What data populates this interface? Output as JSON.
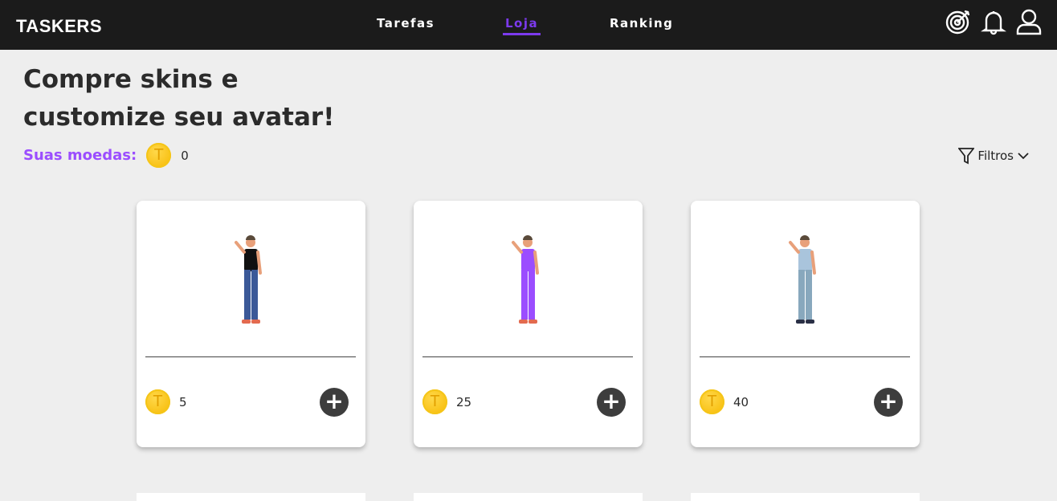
{
  "nav": {
    "logo": "TASKERS",
    "links": [
      {
        "label": "Tarefas",
        "active": false
      },
      {
        "label": "Loja",
        "active": true
      },
      {
        "label": "Ranking",
        "active": false
      }
    ],
    "icons": [
      "target-icon",
      "bell-icon",
      "user-icon"
    ],
    "accent": "#7c3aed"
  },
  "page": {
    "title_line1": "Compre skins e",
    "title_line2": "customize seu avatar!",
    "coins_label": "Suas moedas:",
    "coins_value": "0",
    "coin_symbol": "T",
    "filter_label": "Filtros"
  },
  "cards": [
    {
      "price": "5",
      "shirt": "#111111",
      "pants": "#3b5998",
      "shoes": "#e36a4f"
    },
    {
      "price": "25",
      "shirt": "#9b4dff",
      "pants": "#9b4dff",
      "shoes": "#e36a4f"
    },
    {
      "price": "40",
      "shirt": "#a9c4dc",
      "pants": "#88a8bd",
      "shoes": "#2a2f45"
    }
  ]
}
